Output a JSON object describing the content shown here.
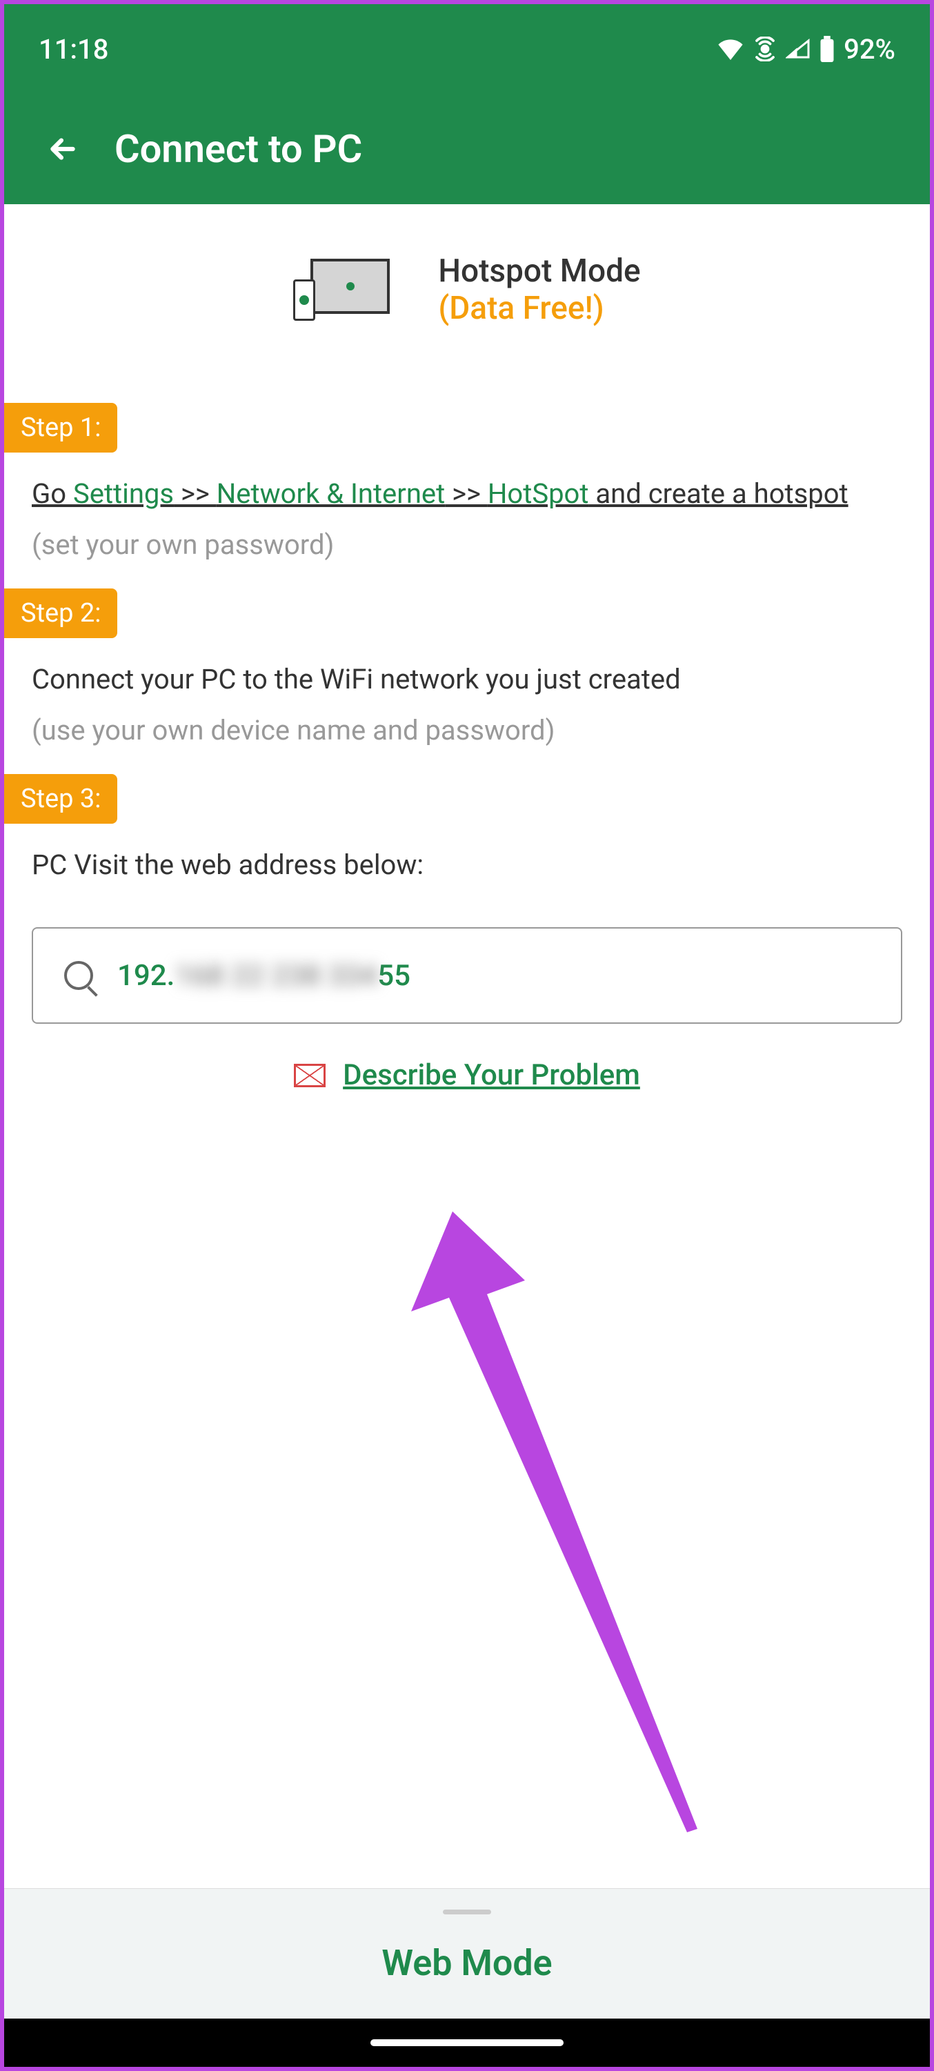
{
  "statusBar": {
    "time": "11:18",
    "batteryPercent": "92%"
  },
  "header": {
    "title": "Connect to PC"
  },
  "mode": {
    "title": "Hotspot Mode",
    "subtitle": "(Data Free!)"
  },
  "steps": {
    "step1": {
      "label": "Step 1:",
      "textGo": "Go ",
      "textSettings": "Settings",
      "textArrow1": " >> ",
      "textNetwork": "Network & Internet",
      "textArrow2": " >> ",
      "textHotspot": "HotSpot",
      "textEnd": " and create a hotspot",
      "hint": "(set your own password)"
    },
    "step2": {
      "label": "Step 2:",
      "text": "Connect your PC to the WiFi network you just created",
      "hint": "(use your own device name and password)"
    },
    "step3": {
      "label": "Step 3:",
      "text": "PC Visit the web address below:"
    }
  },
  "address": {
    "prefix": "192.",
    "blurred": "168 22 238 334",
    "suffix": "55"
  },
  "problemLink": "Describe Your Problem",
  "bottomSheet": {
    "label": "Web Mode"
  }
}
